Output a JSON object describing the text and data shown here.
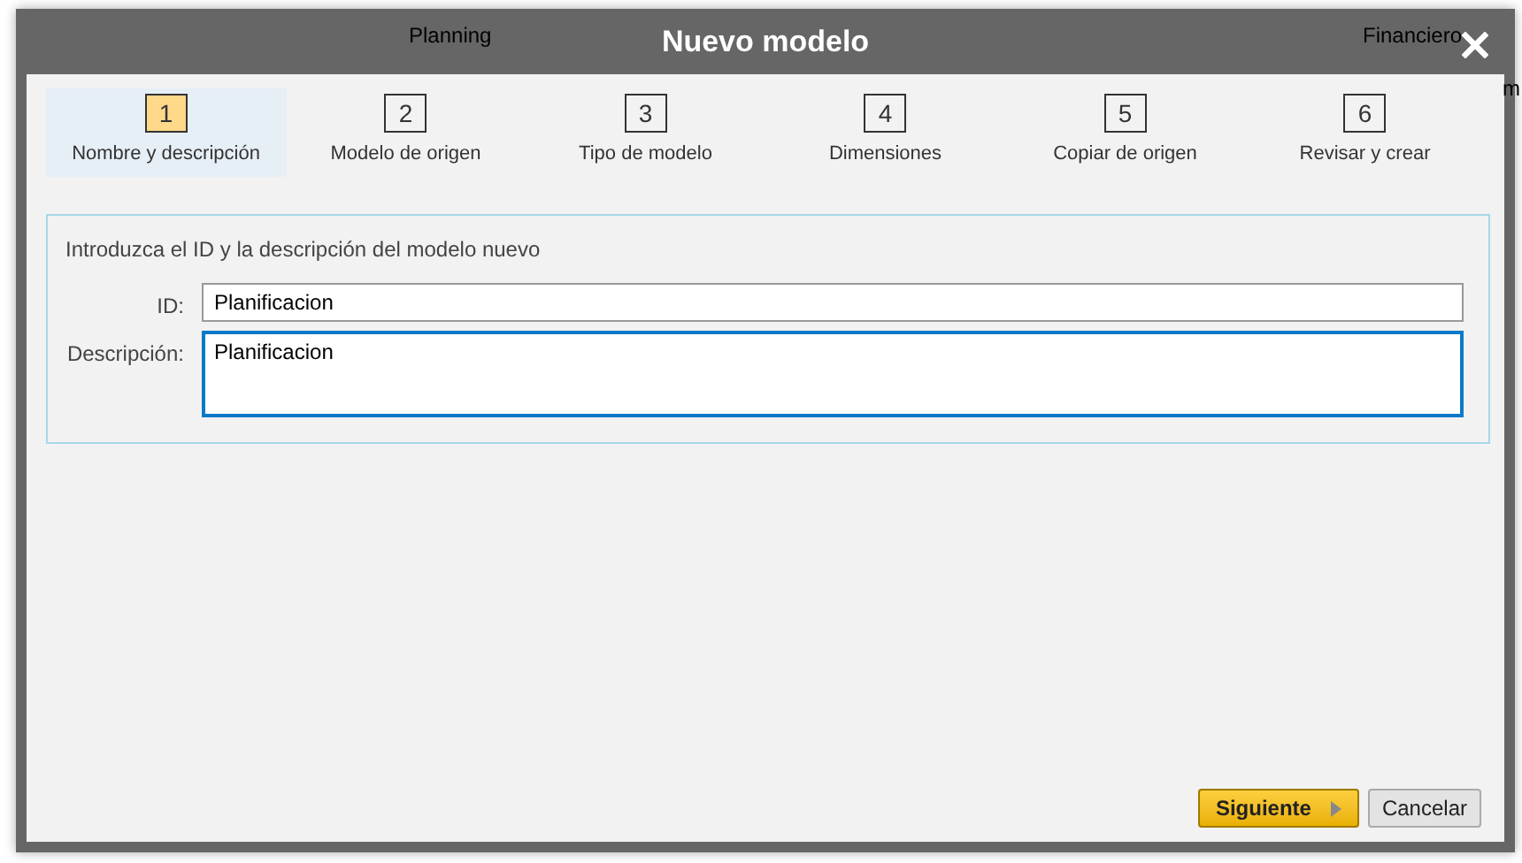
{
  "background_page": {
    "texts": [
      "Planning",
      "Financiero",
      "m"
    ]
  },
  "dialog": {
    "title": "Nuevo modelo",
    "steps": [
      {
        "number": "1",
        "label": "Nombre y descripción",
        "selected": true
      },
      {
        "number": "2",
        "label": "Modelo de origen",
        "selected": false
      },
      {
        "number": "3",
        "label": "Tipo de modelo",
        "selected": false
      },
      {
        "number": "4",
        "label": "Dimensiones",
        "selected": false
      },
      {
        "number": "5",
        "label": "Copiar de origen",
        "selected": false
      },
      {
        "number": "6",
        "label": "Revisar y crear",
        "selected": false
      }
    ],
    "panel": {
      "instruction": "Introduzca el ID y la descripción del modelo nuevo",
      "fields": [
        {
          "kind": "input",
          "label": "ID:",
          "value": "Planificacion",
          "focused": false
        },
        {
          "kind": "textarea",
          "label": "Descripción:",
          "value": "Planificacion",
          "focused": true
        }
      ]
    },
    "buttons": [
      {
        "kind": "primary",
        "label": "Siguiente"
      },
      {
        "kind": "secondary",
        "label": "Cancelar"
      }
    ]
  }
}
